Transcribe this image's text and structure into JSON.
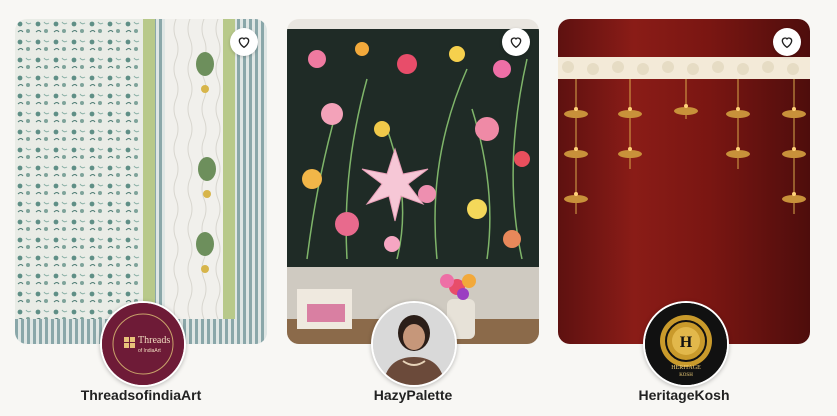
{
  "shops": [
    {
      "name": "ThreadsofindiaArt",
      "logo_text_1": "Threads",
      "logo_text_2": "of IndiaArt"
    },
    {
      "name": "HazyPalette"
    },
    {
      "name": "HeritageKosh",
      "logo_text_1": "HERITAGE",
      "logo_text_2": "KOSH"
    }
  ],
  "icons": {
    "favorite": "heart-outline-icon"
  },
  "colors": {
    "background": "#f8f7f4",
    "threads_logo_bg": "#6e1b37",
    "heritage_logo_bg": "#111111"
  }
}
